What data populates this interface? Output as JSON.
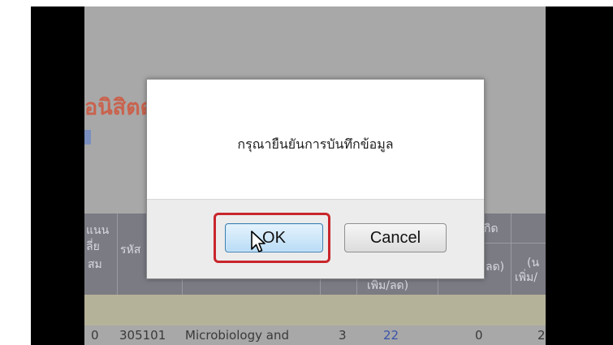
{
  "background": {
    "heading": "อนิสิตต",
    "table_head_cells": [
      "แนน",
      "ลี่ย",
      "สม",
      "รหัส",
      "กิด",
      "เพิ่ม/ลด)",
      "ลด)",
      "(น",
      "เพิ่ม/"
    ],
    "row": {
      "c1": "0",
      "code": "305101",
      "name": "Microbiology and",
      "credits": "3",
      "value_a": "22",
      "value_b": "0",
      "value_c": "2"
    }
  },
  "dialog": {
    "message": "กรุณายืนยันการบันทึกข้อมูล",
    "ok_label": "OK",
    "cancel_label": "Cancel"
  },
  "colors": {
    "highlight": "#c8262c",
    "heading": "#c9634e"
  },
  "icons": {
    "cursor": "mouse-pointer-icon"
  }
}
